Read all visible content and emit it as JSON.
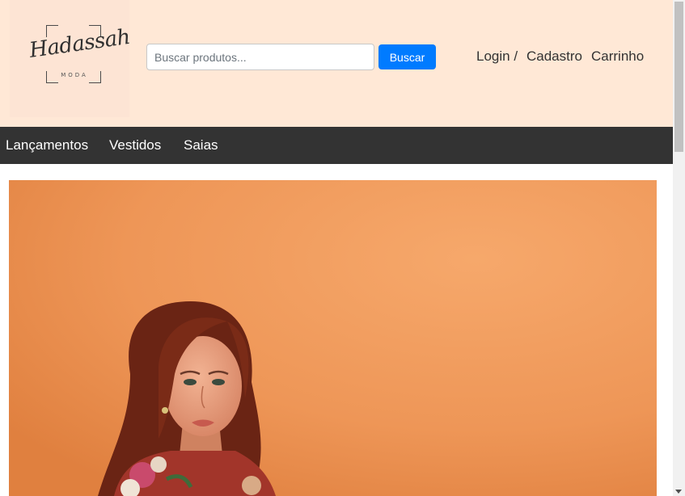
{
  "logo": {
    "script_text": "Hadassah",
    "sub_text": "MODA"
  },
  "search": {
    "placeholder": "Buscar produtos...",
    "value": "",
    "button_label": "Buscar"
  },
  "user_links": {
    "login": "Login /",
    "cadastro": "Cadastro",
    "carrinho": "Carrinho"
  },
  "nav": {
    "items": [
      {
        "label": "Lançamentos"
      },
      {
        "label": "Vestidos"
      },
      {
        "label": "Saias"
      }
    ]
  },
  "colors": {
    "header_bg": "#ffe8d6",
    "nav_bg": "#333333",
    "button": "#007bff",
    "banner_bg": "#ef9a5c"
  }
}
